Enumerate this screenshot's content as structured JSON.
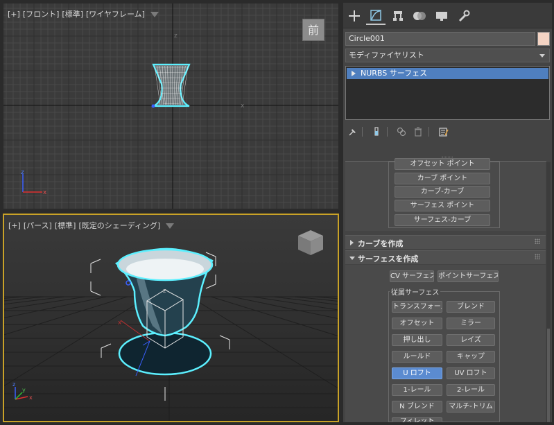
{
  "viewports": {
    "front": {
      "label_plus": "[+]",
      "label_view": "[フロント]",
      "label_standard": "[標準]",
      "label_shading": "[ワイヤフレーム]",
      "cube_text": "前",
      "axis_z": "z",
      "axis_x": "x"
    },
    "perspective": {
      "label_plus": "[+]",
      "label_view": "[パース]",
      "label_standard": "[標準]",
      "label_shading": "[既定のシェーディング]",
      "axis_z": "z",
      "axis_x": "x",
      "axis_y": "y"
    }
  },
  "command_panel": {
    "tabs": [
      {
        "icon": "plus-icon",
        "active": false
      },
      {
        "icon": "modify-icon",
        "active": true
      },
      {
        "icon": "hierarchy-icon",
        "active": false
      },
      {
        "icon": "motion-icon",
        "active": false
      },
      {
        "icon": "display-icon",
        "active": false
      },
      {
        "icon": "utilities-icon",
        "active": false
      }
    ],
    "object_name": "Circle001",
    "object_color": "#f4d4c4",
    "modifier_list": "モディファイヤリスト",
    "stack_item": "NURBS サーフェス",
    "top_buttons": [
      "オフセット ポイント",
      "カーブ ポイント",
      "カーブ-カーブ",
      "サーフェス ポイント",
      "サーフェス-カーブ"
    ],
    "rollout_curve": "カーブを作成",
    "rollout_surface": "サーフェスを作成",
    "cv_surface": "CV サーフェス",
    "point_surface": "ポイントサーフェス",
    "dependent_group": "従属サーフェス",
    "dependent_buttons": [
      [
        "トランスフォーム",
        "ブレンド"
      ],
      [
        "オフセット",
        "ミラー"
      ],
      [
        "押し出し",
        "レイズ"
      ],
      [
        "ルールド",
        "キャップ"
      ],
      [
        "U ロフト",
        "UV ロフト"
      ],
      [
        "1-レール",
        "2-レール"
      ],
      [
        "N ブレンド",
        "マルチ-トリム"
      ],
      [
        "フィレット",
        ""
      ]
    ],
    "active_button": "U ロフト",
    "accent_color": "#5b8bd0",
    "selection_color": "#4f7fbf",
    "active_viewport_border": "#c9a227"
  }
}
